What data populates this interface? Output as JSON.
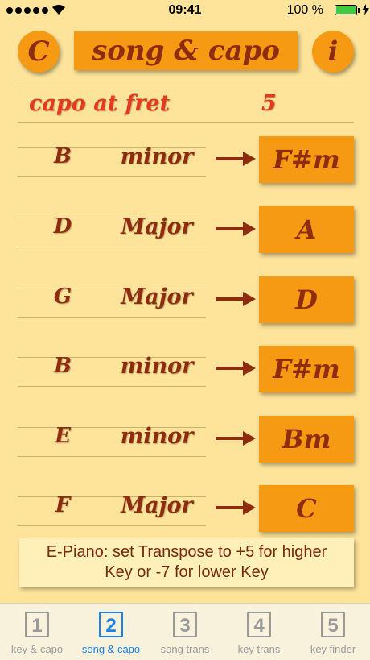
{
  "status": {
    "time": "09:41",
    "battery": "100 %"
  },
  "header": {
    "left_button": "C",
    "title": "song & capo",
    "info_button": "i"
  },
  "capo": {
    "label": "capo at fret",
    "value": "5"
  },
  "chords": [
    {
      "root": "B",
      "quality": "minor",
      "result": "F#m"
    },
    {
      "root": "D",
      "quality": "Major",
      "result": "A"
    },
    {
      "root": "G",
      "quality": "Major",
      "result": "D"
    },
    {
      "root": "B",
      "quality": "minor",
      "result": "F#m"
    },
    {
      "root": "E",
      "quality": "minor",
      "result": "Bm"
    },
    {
      "root": "F",
      "quality": "Major",
      "result": "C"
    }
  ],
  "note": {
    "line1": "E-Piano: set Transpose to +5 for higher",
    "line2": "Key or -7 for lower Key"
  },
  "tabs": [
    {
      "num": "1",
      "label": "key & capo"
    },
    {
      "num": "2",
      "label": "song & capo"
    },
    {
      "num": "3",
      "label": "song trans"
    },
    {
      "num": "4",
      "label": "key trans"
    },
    {
      "num": "5",
      "label": "key finder"
    }
  ],
  "colors": {
    "background": "#fde49a",
    "button": "#f69a14",
    "text": "#8f2c10",
    "capo_text": "#e63a1e",
    "active_tab": "#1a82e8"
  }
}
